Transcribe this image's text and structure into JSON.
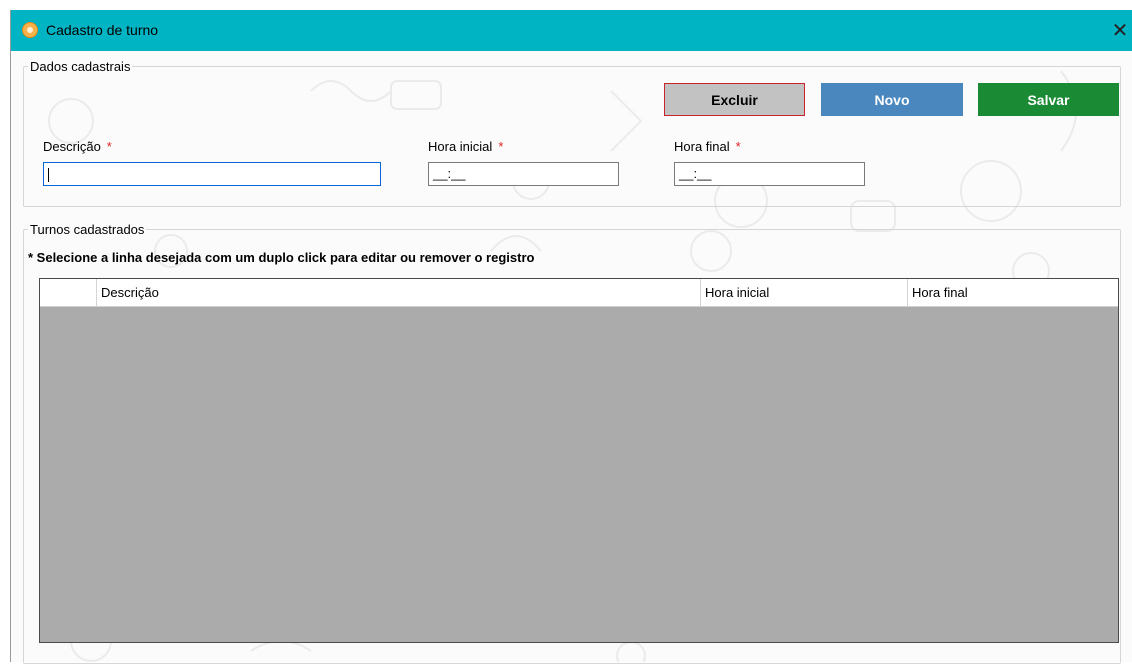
{
  "window": {
    "title": "Cadastro de turno",
    "close_glyph": "✕"
  },
  "dados": {
    "legend": "Dados cadastrais",
    "buttons": {
      "excluir": "Excluir",
      "novo": "Novo",
      "salvar": "Salvar"
    },
    "fields": {
      "descricao": {
        "label": "Descrição",
        "required_mark": "*",
        "value": ""
      },
      "hora_inicial": {
        "label": "Hora inicial",
        "required_mark": "*",
        "value": "__:__"
      },
      "hora_final": {
        "label": "Hora final",
        "required_mark": "*",
        "value": "__:__"
      }
    }
  },
  "turnos": {
    "legend": "Turnos cadastrados",
    "instruction": "* Selecione a linha desejada com um duplo click para editar ou remover o registro",
    "columns": [
      "",
      "Descrição",
      "Hora inicial",
      "Hora final"
    ],
    "rows": []
  },
  "colors": {
    "titlebar": "#00b4c3",
    "excluir_bg": "#c2c2c2",
    "excluir_border": "#c9232b",
    "novo_bg": "#4b87bf",
    "salvar_bg": "#1a8a35",
    "grid_bg": "#ababab"
  }
}
